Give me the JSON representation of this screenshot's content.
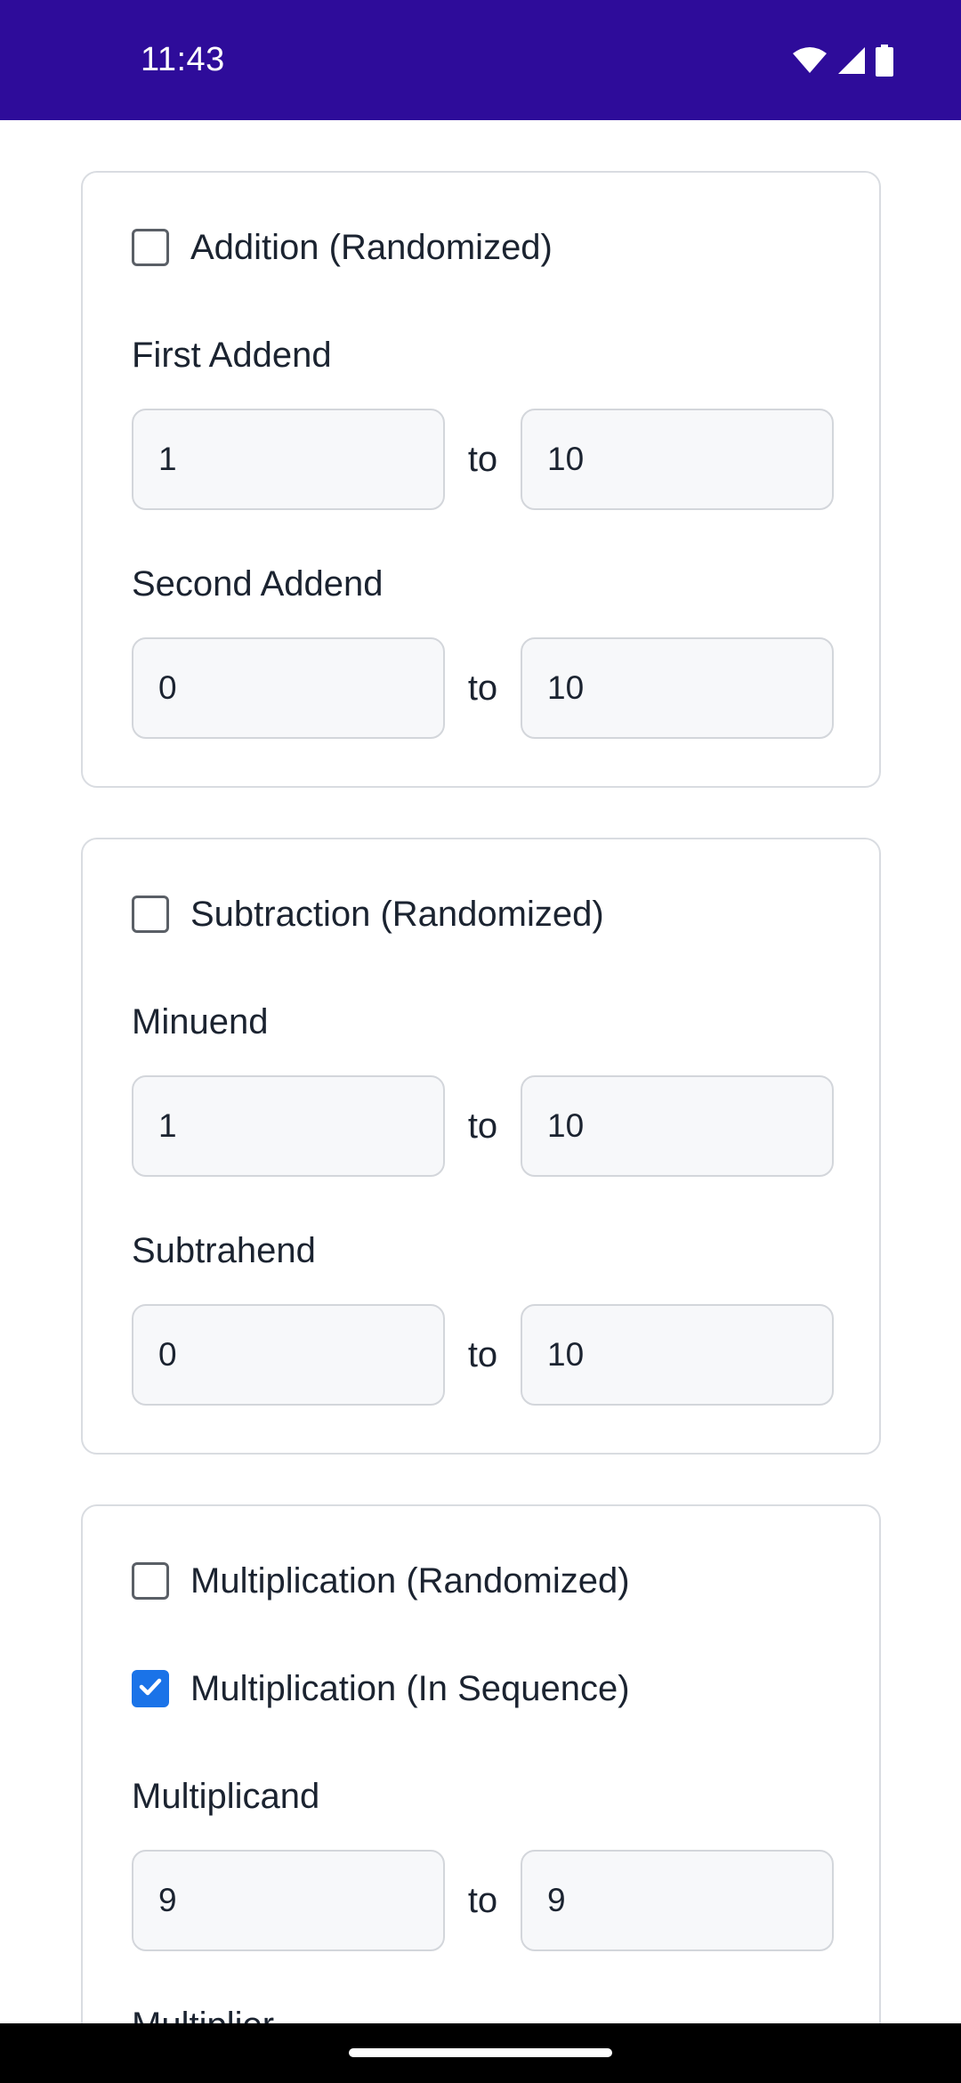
{
  "status_bar": {
    "time": "11:43",
    "icons": [
      "wifi-icon",
      "signal-icon",
      "battery-icon"
    ],
    "background": "#2e0c9a"
  },
  "sections": [
    {
      "checkboxes": [
        {
          "label": "Addition (Randomized)",
          "checked": false
        }
      ],
      "ranges": [
        {
          "label": "First Addend",
          "from": "1",
          "to": "10"
        },
        {
          "label": "Second Addend",
          "from": "0",
          "to": "10"
        }
      ]
    },
    {
      "checkboxes": [
        {
          "label": "Subtraction (Randomized)",
          "checked": false
        }
      ],
      "ranges": [
        {
          "label": "Minuend",
          "from": "1",
          "to": "10"
        },
        {
          "label": "Subtrahend",
          "from": "0",
          "to": "10"
        }
      ]
    },
    {
      "checkboxes": [
        {
          "label": "Multiplication (Randomized)",
          "checked": false
        },
        {
          "label": "Multiplication (In Sequence)",
          "checked": true
        }
      ],
      "ranges": [
        {
          "label": "Multiplicand",
          "from": "9",
          "to": "9"
        },
        {
          "label": "Multiplier",
          "from": "",
          "to": ""
        }
      ]
    }
  ],
  "range_separator": "to",
  "accent_color": "#1a73e8"
}
